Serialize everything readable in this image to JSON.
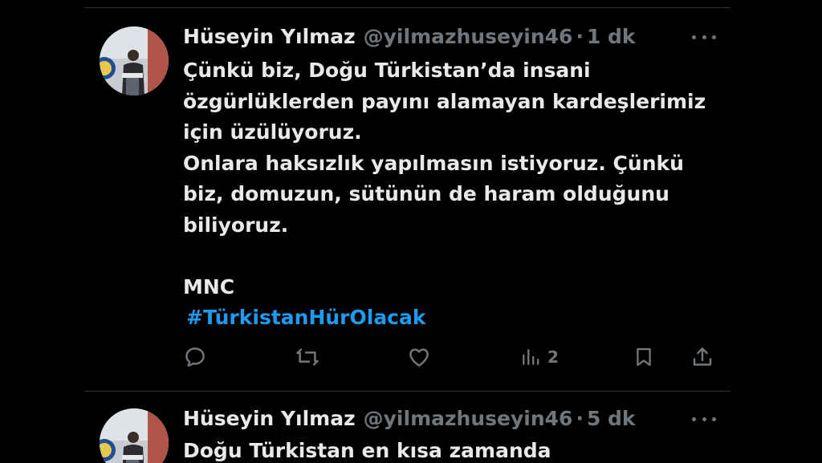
{
  "colors": {
    "background": "#000000",
    "text": "#e7e9ea",
    "secondary": "#71767b",
    "link": "#1d9bf0",
    "divider": "#2f3336"
  },
  "tweets": [
    {
      "author_name": "Hüseyin Yılmaz",
      "author_handle": "@yilmazhuseyin46",
      "separator": "·",
      "time": "1 dk",
      "lines": [
        "Çünkü biz, Doğu Türkistan’da insani",
        "özgürlüklerden payını alamayan kardeşlerimiz",
        "için üzülüyoruz.",
        "Onlara haksızlık yapılmasın istiyoruz. Çünkü",
        "biz, domuzun, sütünün de haram olduğunu",
        "biliyoruz.",
        "",
        "MNC"
      ],
      "hashtag": "#TürkistanHürOlacak",
      "actions": {
        "reply_icon": "reply-icon",
        "retweet_icon": "retweet-icon",
        "like_icon": "like-icon",
        "views_icon": "views-icon",
        "views_count": "2",
        "bookmark_icon": "bookmark-icon",
        "share_icon": "share-icon"
      }
    },
    {
      "author_name": "Hüseyin Yılmaz",
      "author_handle": "@yilmazhuseyin46",
      "separator": "·",
      "time": "5 dk",
      "lines": [
        "Doğu Türkistan en kısa zamanda"
      ]
    }
  ]
}
